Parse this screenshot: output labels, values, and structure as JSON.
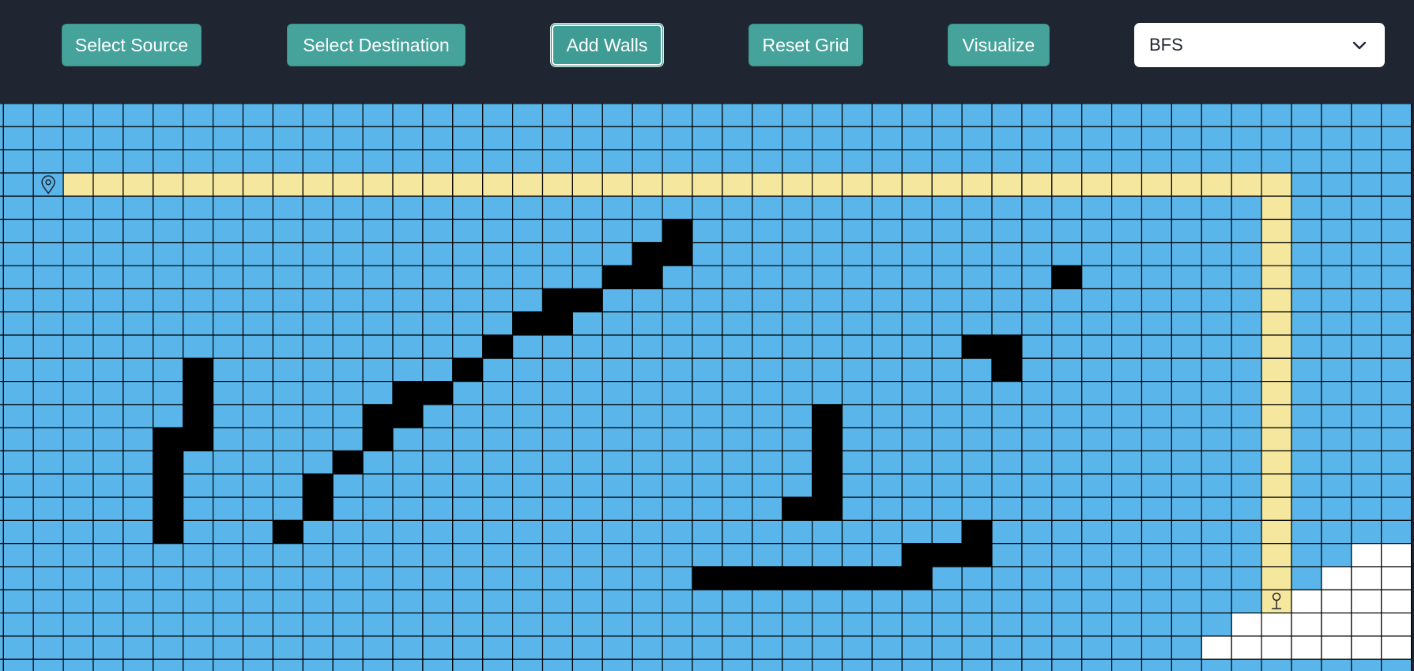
{
  "toolbar": {
    "select_source_label": "Select Source",
    "select_destination_label": "Select Destination",
    "add_walls_label": "Add Walls",
    "reset_grid_label": "Reset Grid",
    "visualize_label": "Visualize",
    "algorithm": {
      "selected": "BFS"
    },
    "active_mode": "Add Walls"
  },
  "grid": {
    "columns": 48,
    "rows": 20,
    "colors": {
      "visited": "#5ab6ea",
      "path": "#f5e79e",
      "wall": "#000000",
      "unvisited": "#ffffff",
      "gridline": "#000000"
    },
    "source": {
      "row": 3,
      "col": 2
    },
    "destination": {
      "row": 21,
      "col": 43
    },
    "path": [
      [
        3,
        3
      ],
      [
        3,
        4
      ],
      [
        3,
        5
      ],
      [
        3,
        6
      ],
      [
        3,
        7
      ],
      [
        3,
        8
      ],
      [
        3,
        9
      ],
      [
        3,
        10
      ],
      [
        3,
        11
      ],
      [
        3,
        12
      ],
      [
        3,
        13
      ],
      [
        3,
        14
      ],
      [
        3,
        15
      ],
      [
        3,
        16
      ],
      [
        3,
        17
      ],
      [
        3,
        18
      ],
      [
        3,
        19
      ],
      [
        3,
        20
      ],
      [
        3,
        21
      ],
      [
        3,
        22
      ],
      [
        3,
        23
      ],
      [
        3,
        24
      ],
      [
        3,
        25
      ],
      [
        3,
        26
      ],
      [
        3,
        27
      ],
      [
        3,
        28
      ],
      [
        3,
        29
      ],
      [
        3,
        30
      ],
      [
        3,
        31
      ],
      [
        3,
        32
      ],
      [
        3,
        33
      ],
      [
        3,
        34
      ],
      [
        3,
        35
      ],
      [
        3,
        36
      ],
      [
        3,
        37
      ],
      [
        3,
        38
      ],
      [
        3,
        39
      ],
      [
        3,
        40
      ],
      [
        3,
        41
      ],
      [
        3,
        42
      ],
      [
        3,
        43
      ],
      [
        4,
        43
      ],
      [
        5,
        43
      ],
      [
        6,
        43
      ],
      [
        7,
        43
      ],
      [
        8,
        43
      ],
      [
        9,
        43
      ],
      [
        10,
        43
      ],
      [
        11,
        43
      ],
      [
        12,
        43
      ],
      [
        13,
        43
      ],
      [
        14,
        43
      ],
      [
        15,
        43
      ],
      [
        16,
        43
      ],
      [
        17,
        43
      ],
      [
        18,
        43
      ],
      [
        19,
        43
      ],
      [
        20,
        43
      ]
    ],
    "walls": [
      [
        5,
        23
      ],
      [
        6,
        23
      ],
      [
        6,
        22
      ],
      [
        7,
        22
      ],
      [
        7,
        21
      ],
      [
        8,
        20
      ],
      [
        8,
        19
      ],
      [
        9,
        19
      ],
      [
        9,
        18
      ],
      [
        10,
        17
      ],
      [
        11,
        16
      ],
      [
        12,
        15
      ],
      [
        12,
        14
      ],
      [
        13,
        14
      ],
      [
        13,
        13
      ],
      [
        14,
        13
      ],
      [
        15,
        12
      ],
      [
        16,
        11
      ],
      [
        17,
        11
      ],
      [
        18,
        10
      ],
      [
        11,
        7
      ],
      [
        12,
        7
      ],
      [
        13,
        7
      ],
      [
        14,
        7
      ],
      [
        14,
        6
      ],
      [
        15,
        6
      ],
      [
        16,
        6
      ],
      [
        17,
        6
      ],
      [
        18,
        6
      ],
      [
        7,
        36
      ],
      [
        10,
        33
      ],
      [
        10,
        34
      ],
      [
        11,
        34
      ],
      [
        13,
        28
      ],
      [
        14,
        28
      ],
      [
        15,
        28
      ],
      [
        16,
        28
      ],
      [
        17,
        28
      ],
      [
        17,
        27
      ],
      [
        18,
        33
      ],
      [
        19,
        33
      ],
      [
        19,
        32
      ],
      [
        19,
        31
      ],
      [
        20,
        31
      ],
      [
        20,
        30
      ],
      [
        20,
        29
      ],
      [
        20,
        28
      ],
      [
        20,
        27
      ],
      [
        20,
        26
      ],
      [
        20,
        25
      ],
      [
        20,
        24
      ]
    ],
    "unvisited": [
      [
        19,
        46
      ],
      [
        19,
        47
      ],
      [
        20,
        45
      ],
      [
        20,
        46
      ],
      [
        20,
        47
      ],
      [
        21,
        44
      ],
      [
        21,
        45
      ],
      [
        21,
        46
      ],
      [
        21,
        47
      ],
      [
        22,
        42
      ],
      [
        22,
        43
      ],
      [
        22,
        44
      ],
      [
        22,
        45
      ],
      [
        22,
        46
      ],
      [
        22,
        47
      ],
      [
        23,
        41
      ],
      [
        23,
        42
      ],
      [
        23,
        43
      ],
      [
        23,
        44
      ],
      [
        23,
        45
      ],
      [
        23,
        46
      ],
      [
        23,
        47
      ]
    ]
  }
}
